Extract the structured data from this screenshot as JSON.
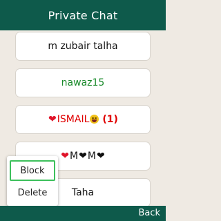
{
  "header": {
    "title": "Private Chat"
  },
  "list": {
    "items": [
      {
        "name": "m zubair talha"
      },
      {
        "name": "nawaz15"
      },
      {
        "name": "ISMAIL",
        "count": "(1)"
      },
      {
        "name_parts": [
          "M",
          "M"
        ]
      },
      {
        "name": "Taha"
      }
    ]
  },
  "popup": {
    "options": [
      "Block",
      "Delete"
    ]
  },
  "footer": {
    "back_label": "Back"
  },
  "colors": {
    "header_bg": "#0e5a4b",
    "selected_outline": "#3cc05b",
    "green_name": "#198a2a",
    "unread_red": "#e00000"
  }
}
